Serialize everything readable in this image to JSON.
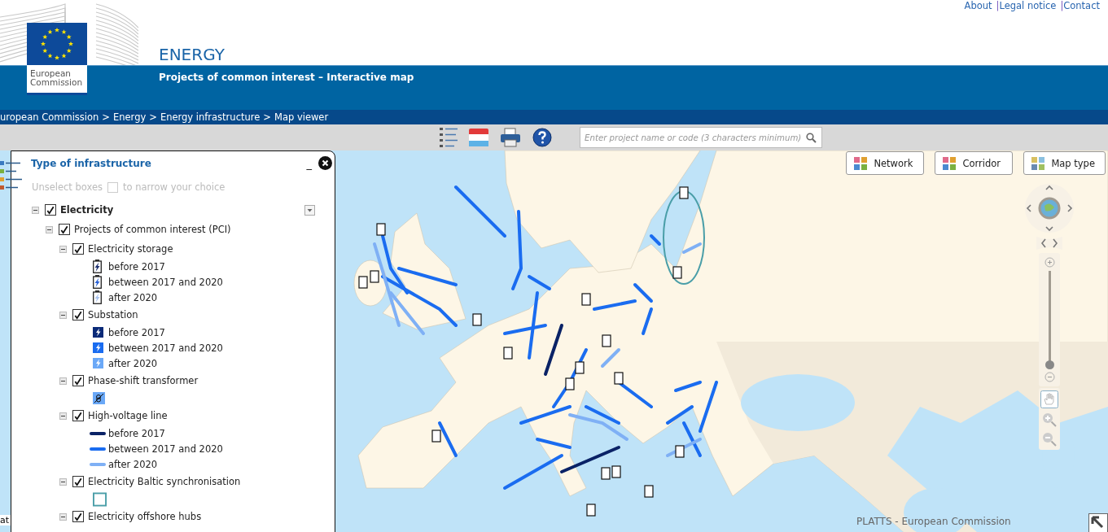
{
  "top_links": {
    "separator": "|",
    "items": [
      {
        "label": "About"
      },
      {
        "label": "Legal notice"
      },
      {
        "label": "Contact"
      }
    ]
  },
  "logo": {
    "line_1": "European",
    "line_2": "Commission"
  },
  "site_title": "ENERGY",
  "subtitle": "Projects of common interest – Interactive map",
  "breadcrumb": {
    "separator": ">",
    "items": [
      "uropean Commission",
      "Energy",
      "Energy infrastructure",
      "Map viewer"
    ]
  },
  "search": {
    "placeholder": "Enter project name or code (3 characters minimum)"
  },
  "panel": {
    "title": "Type of infrastructure",
    "minimize": "_",
    "hint_before": "Unselect boxes",
    "hint_after": "to narrow your choice",
    "hint_checked": false,
    "tree": [
      {
        "label": "Electricity",
        "checked": true,
        "expanded": true,
        "has_menu": true,
        "children": [
          {
            "label": "Projects of common interest (PCI)",
            "checked": true,
            "expanded": true,
            "children": [
              {
                "label": "Electricity storage",
                "checked": true,
                "expanded": true,
                "legend": [
                  {
                    "kind": "battery",
                    "label": "before 2017",
                    "color": "#1c2f70"
                  },
                  {
                    "kind": "battery",
                    "label": "between 2017 and 2020",
                    "color": "#2a62d6"
                  },
                  {
                    "kind": "battery",
                    "label": "after 2020",
                    "color": "#a9c2ee"
                  }
                ]
              },
              {
                "label": "Substation",
                "checked": true,
                "expanded": true,
                "legend": [
                  {
                    "kind": "square",
                    "label": "before 2017",
                    "color": "#0a2a78"
                  },
                  {
                    "kind": "square",
                    "label": "between 2017 and 2020",
                    "color": "#1a6cf0"
                  },
                  {
                    "kind": "square",
                    "label": "after 2020",
                    "color": "#6aa8f7"
                  }
                ]
              },
              {
                "label": "Phase-shift transformer",
                "checked": true,
                "expanded": true,
                "legend": [
                  {
                    "kind": "transformer",
                    "color": "#6aa8f7"
                  }
                ]
              },
              {
                "label": "High-voltage line",
                "checked": true,
                "expanded": true,
                "legend": [
                  {
                    "kind": "line",
                    "label": "before 2017",
                    "color": "#0a2266"
                  },
                  {
                    "kind": "line",
                    "label": "between 2017 and 2020",
                    "color": "#1a6cf0"
                  },
                  {
                    "kind": "line",
                    "label": "after 2020",
                    "color": "#7fb0f5"
                  }
                ]
              },
              {
                "label": "Electricity Baltic synchronisation",
                "checked": true,
                "expanded": true,
                "legend": [
                  {
                    "kind": "outline",
                    "color": "#4a9ea8"
                  }
                ]
              },
              {
                "label": "Electricity offshore hubs",
                "checked": true,
                "expanded": true
              }
            ]
          }
        ]
      }
    ]
  },
  "map_buttons": [
    {
      "label": "Network",
      "kind": "grid"
    },
    {
      "label": "Corridor",
      "kind": "grid"
    },
    {
      "label": "Map type",
      "kind": "tiles"
    }
  ],
  "zoom_slider": {
    "level": 0.03
  },
  "side_label": "at",
  "attribution": "PLATTS - European Commission"
}
